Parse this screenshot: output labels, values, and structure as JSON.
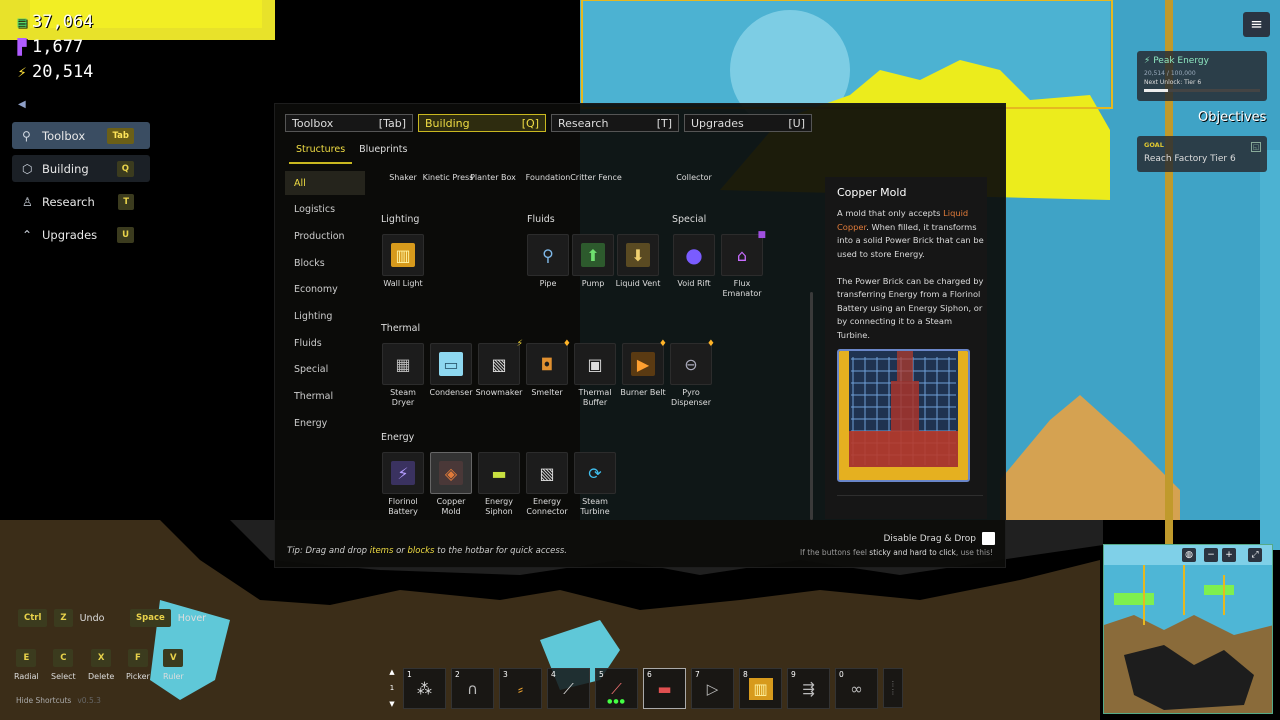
{
  "resources": [
    {
      "icon": "coin-icon",
      "value": "37,064",
      "color": "#4cd46c"
    },
    {
      "icon": "research-icon",
      "value": "1,677",
      "color": "#b05cff"
    },
    {
      "icon": "energy-icon",
      "value": "20,514",
      "color": "#ffe23c"
    }
  ],
  "side_menu": [
    {
      "label": "Toolbox",
      "key": "Tab",
      "icon": "wrench-icon"
    },
    {
      "label": "Building",
      "key": "Q",
      "icon": "cube-icon"
    },
    {
      "label": "Research",
      "key": "T",
      "icon": "person-icon"
    },
    {
      "label": "Upgrades",
      "key": "U",
      "icon": "chevron-up-icon"
    }
  ],
  "tabs": [
    {
      "label": "Toolbox",
      "key": "[Tab]"
    },
    {
      "label": "Building",
      "key": "[Q]"
    },
    {
      "label": "Research",
      "key": "[T]"
    },
    {
      "label": "Upgrades",
      "key": "[U]"
    }
  ],
  "subtabs": [
    "Structures",
    "Blueprints"
  ],
  "categories": [
    "All",
    "Logistics",
    "Production",
    "Blocks",
    "Economy",
    "Lighting",
    "Fluids",
    "Special",
    "Thermal",
    "Energy"
  ],
  "top_row_labels": [
    "Shaker",
    "Kinetic Press",
    "Planter Box",
    "Foundation",
    "Critter Fence",
    "Collector"
  ],
  "sections": {
    "lighting": {
      "title": "Lighting",
      "items": [
        "Wall Light"
      ]
    },
    "fluids": {
      "title": "Fluids",
      "items": [
        "Pipe",
        "Pump",
        "Liquid Vent"
      ]
    },
    "special": {
      "title": "Special",
      "items": [
        "Void Rift",
        "Flux Emanator"
      ]
    },
    "thermal": {
      "title": "Thermal",
      "items": [
        "Steam Dryer",
        "Condenser",
        "Snowmaker",
        "Smelter",
        "Thermal Buffer",
        "Burner Belt",
        "Pyro Dispenser"
      ]
    },
    "energy": {
      "title": "Energy",
      "items": [
        "Florinol Battery",
        "Copper Mold",
        "Energy Siphon",
        "Energy Connector",
        "Steam Turbine"
      ]
    }
  },
  "detail": {
    "title": "Copper Mold",
    "desc_1": "A mold that only accepts ",
    "desc_hl": "Liquid Copper",
    "desc_2": ". When filled, it transforms into a solid Power Brick that can be used to store Energy.",
    "desc_3": "The Power Brick can be charged by transferring Energy from a Florinol Battery using an Energy Siphon, or by connecting it to a Steam Turbine."
  },
  "tip": {
    "prefix": "Tip: Drag and drop ",
    "items": "items",
    "mid": " or ",
    "blocks": "blocks",
    "suffix": " to the hotbar for quick access."
  },
  "drag_drop": {
    "label": "Disable Drag & Drop",
    "note_1": "If the buttons feel ",
    "note_b": "sticky and hard to click",
    "note_2": ", use this!"
  },
  "peak_energy": {
    "title": "Peak Energy",
    "value": "20,514 / 100,000",
    "next": "Next Unlock: Tier 6",
    "progress": 0.205
  },
  "objectives": "Objectives",
  "goal": {
    "label": "GOAL",
    "text": "Reach Factory Tier 6"
  },
  "shortcuts": [
    {
      "keys": [
        "Ctrl",
        "Z"
      ],
      "label": "Undo"
    },
    {
      "keys": [
        "Space"
      ],
      "label": "Hover"
    }
  ],
  "key_grid": [
    {
      "key": "E",
      "label": "Radial"
    },
    {
      "key": "C",
      "label": "Select"
    },
    {
      "key": "X",
      "label": "Delete"
    },
    {
      "key": "F",
      "label": "Picker"
    },
    {
      "key": "V",
      "label": "Ruler"
    }
  ],
  "hide_shortcuts": "Hide Shortcuts",
  "version": "v0.5.3",
  "hotbar": {
    "page_up": "▲",
    "page": "1",
    "page_down": "▼",
    "slots": [
      {
        "num": "1",
        "icon": "ore-icon"
      },
      {
        "num": "2",
        "icon": "magnet-icon"
      },
      {
        "num": "3",
        "icon": "drill-icon"
      },
      {
        "num": "4",
        "icon": "laser-icon"
      },
      {
        "num": "5",
        "icon": "sword-icon"
      },
      {
        "num": "6",
        "icon": "gun-icon"
      },
      {
        "num": "7",
        "icon": "flag-icon"
      },
      {
        "num": "8",
        "icon": "wall-light-icon"
      },
      {
        "num": "9",
        "icon": "dash-icon"
      },
      {
        "num": "0",
        "icon": "chain-icon"
      }
    ]
  }
}
